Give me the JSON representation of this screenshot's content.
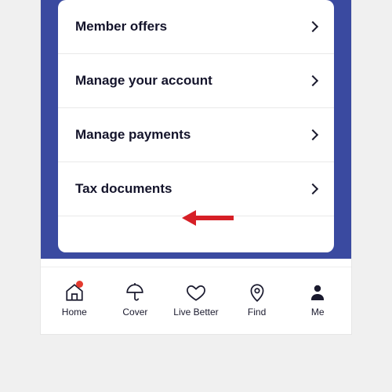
{
  "menu": {
    "items": [
      {
        "label": "Member offers"
      },
      {
        "label": "Manage your account"
      },
      {
        "label": "Manage payments"
      },
      {
        "label": "Tax documents"
      }
    ]
  },
  "nav": {
    "items": [
      {
        "label": "Home"
      },
      {
        "label": "Cover"
      },
      {
        "label": "Live Better"
      },
      {
        "label": "Find"
      },
      {
        "label": "Me"
      }
    ]
  }
}
